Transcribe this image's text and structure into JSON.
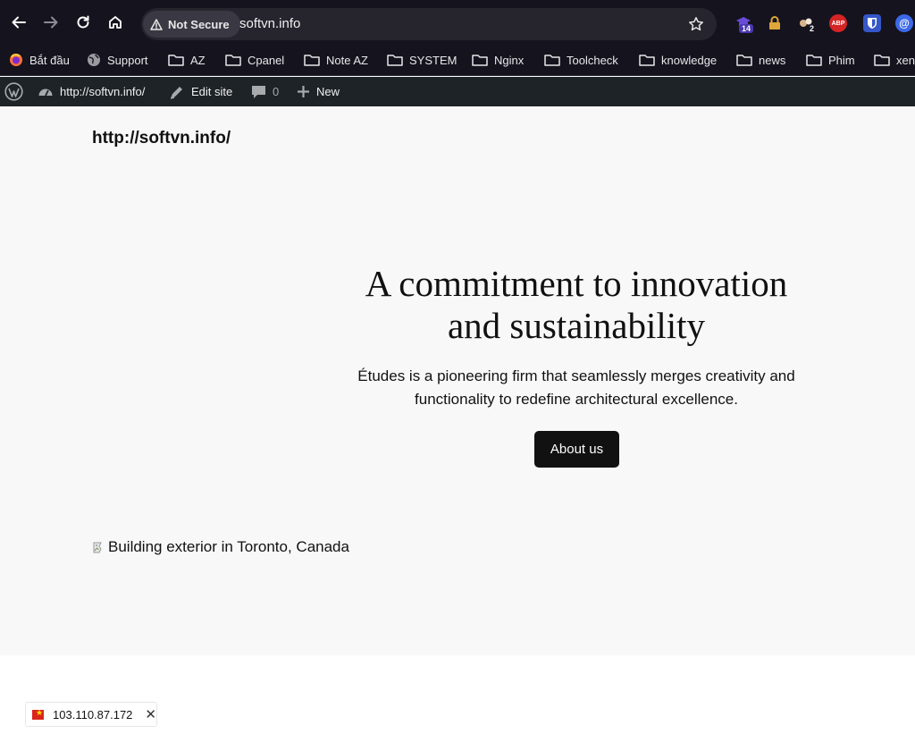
{
  "browser": {
    "security_label": "Not Secure",
    "url": "softvn.info",
    "extensions": [
      {
        "name": "extension-badge-14",
        "badge": "14",
        "color": "#5b3cc4"
      },
      {
        "name": "lock-extension",
        "badge": "",
        "color": "#d9a23b"
      },
      {
        "name": "extension-badge-2",
        "badge": "2",
        "color": "#c9a47c"
      },
      {
        "name": "adblock-plus",
        "label": "ABP",
        "color": "#d42424"
      },
      {
        "name": "bitwarden-extension",
        "badge": "",
        "color": "#3557c8"
      },
      {
        "name": "account-extension",
        "badge": "",
        "color": "#3c69e7"
      }
    ]
  },
  "bookmarks": [
    {
      "label": "Bắt đầu",
      "icon": "firefox-icon"
    },
    {
      "label": "Support",
      "icon": "globe-icon"
    },
    {
      "label": "AZ",
      "icon": "folder-icon"
    },
    {
      "label": "Cpanel",
      "icon": "folder-icon"
    },
    {
      "label": "Note AZ",
      "icon": "folder-icon"
    },
    {
      "label": "SYSTEM",
      "icon": "folder-icon"
    },
    {
      "label": "Nginx",
      "icon": "folder-icon"
    },
    {
      "label": "Toolcheck",
      "icon": "folder-icon"
    },
    {
      "label": "knowledge",
      "icon": "folder-icon"
    },
    {
      "label": "news",
      "icon": "folder-icon"
    },
    {
      "label": "Phim",
      "icon": "folder-icon"
    },
    {
      "label": "xen",
      "icon": "folder-icon"
    }
  ],
  "adminbar": {
    "site_link": "http://softvn.info/",
    "edit_site": "Edit site",
    "comments_count": "0",
    "new_label": "New"
  },
  "page": {
    "site_title": "http://softvn.info/",
    "hero_heading_line1": "A commitment to innovation",
    "hero_heading_line2": "and sustainability",
    "hero_sub_line1": "Études is a pioneering firm that seamlessly merges creativity and",
    "hero_sub_line2": "functionality to redefine architectural excellence.",
    "about_button": "About us",
    "image_alt": "Building exterior in Toronto, Canada"
  },
  "status": {
    "ip": "103.110.87.172"
  }
}
